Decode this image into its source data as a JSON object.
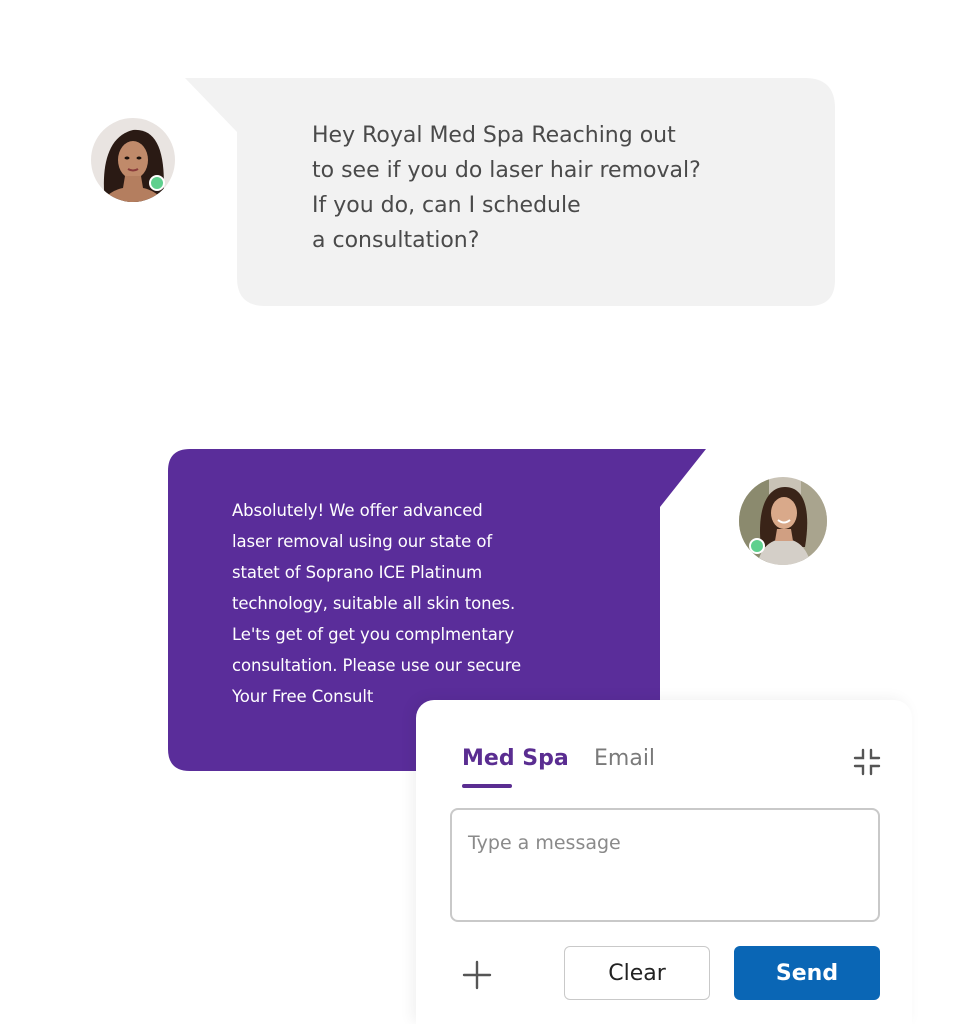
{
  "conversation": {
    "incoming": {
      "avatar_icon": "customer-avatar",
      "status": "online",
      "status_color": "#5fd08e",
      "bubble_color": "#f2f2f2",
      "text": "Hey Royal Med Spa Reaching out\nto see if you do laser hair removal?\nIf you do, can I schedule\na consultation?"
    },
    "outgoing": {
      "avatar_icon": "staff-avatar",
      "status": "online",
      "status_color": "#5fd08e",
      "bubble_color": "#5a2d9a",
      "text": "Absolutely! We offer advanced\nlaser removal using our state of\nstatet of Soprano ICE Platinum\ntechnology, suitable all skin tones.\nLe'ts get of get you complmentary\nconsultation. Please use our secure\nYour Free Consult"
    }
  },
  "composer": {
    "tabs": [
      {
        "label": "Med Spa",
        "active": true
      },
      {
        "label": "Email",
        "active": false
      }
    ],
    "collapse_icon": "collapse-icon",
    "input": {
      "value": "",
      "placeholder": "Type a message"
    },
    "add_icon": "plus-icon",
    "clear_label": "Clear",
    "send_label": "Send",
    "accent_color": "#5a2d91",
    "send_color": "#0a66b5"
  }
}
